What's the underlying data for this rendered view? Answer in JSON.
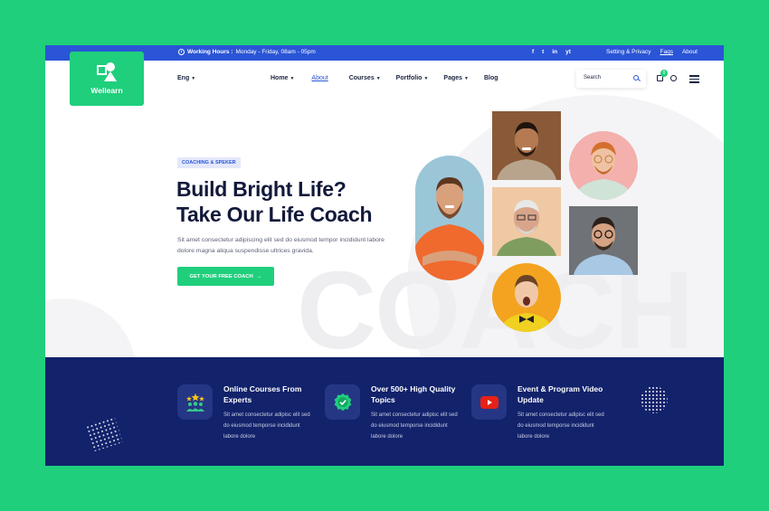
{
  "topbar": {
    "working_hours_label": "Working Hours :",
    "working_hours_value": "Monday - Friday, 08am - 05pm",
    "socials": [
      "f",
      "t",
      "in",
      "yt"
    ],
    "links": [
      "Setting & Privacy",
      "Faqs",
      "About"
    ]
  },
  "logo": {
    "text": "Wellearn"
  },
  "nav": {
    "language": "Eng",
    "items": [
      {
        "label": "Home",
        "dropdown": true
      },
      {
        "label": "About",
        "dropdown": false,
        "active": true
      },
      {
        "label": "Courses",
        "dropdown": true
      },
      {
        "label": "Portfolio",
        "dropdown": true
      },
      {
        "label": "Pages",
        "dropdown": true
      },
      {
        "label": "Blog",
        "dropdown": false
      }
    ],
    "search_placeholder": "Search",
    "cart_count": "0"
  },
  "hero": {
    "tag": "COACHING & SPEKER",
    "title_line1": "Build Bright Life?",
    "title_line2": "Take Our Life Coach",
    "description": "Sit amet consectetur adipiscing elit sed do eiusmod tempor incididunt labore dolore magna aliqua suspendisse ultrices gravida.",
    "cta_label": "GET YOUR FREE COACH",
    "watermark": "COACH"
  },
  "features": [
    {
      "title": "Online Courses From Experts",
      "description": "Sit amet consectetur adipisc elit sed do eiusmod temporse incididunt labore dolore",
      "icon": "team-stars-icon"
    },
    {
      "title": "Over 500+ High Quality Topics",
      "description": "Sit amet consectetur adipisc elit sed do eiusmod temporse incididunt labore dolore",
      "icon": "verified-badge-icon"
    },
    {
      "title": "Event & Program Video Update",
      "description": "Sit amet consectetur adipisc elit sed do eiusmod temporse incididunt labore dolore",
      "icon": "youtube-play-icon"
    }
  ],
  "colors": {
    "brand_green": "#1fcf7c",
    "brand_blue": "#2a55d6",
    "navy": "#12226b"
  }
}
